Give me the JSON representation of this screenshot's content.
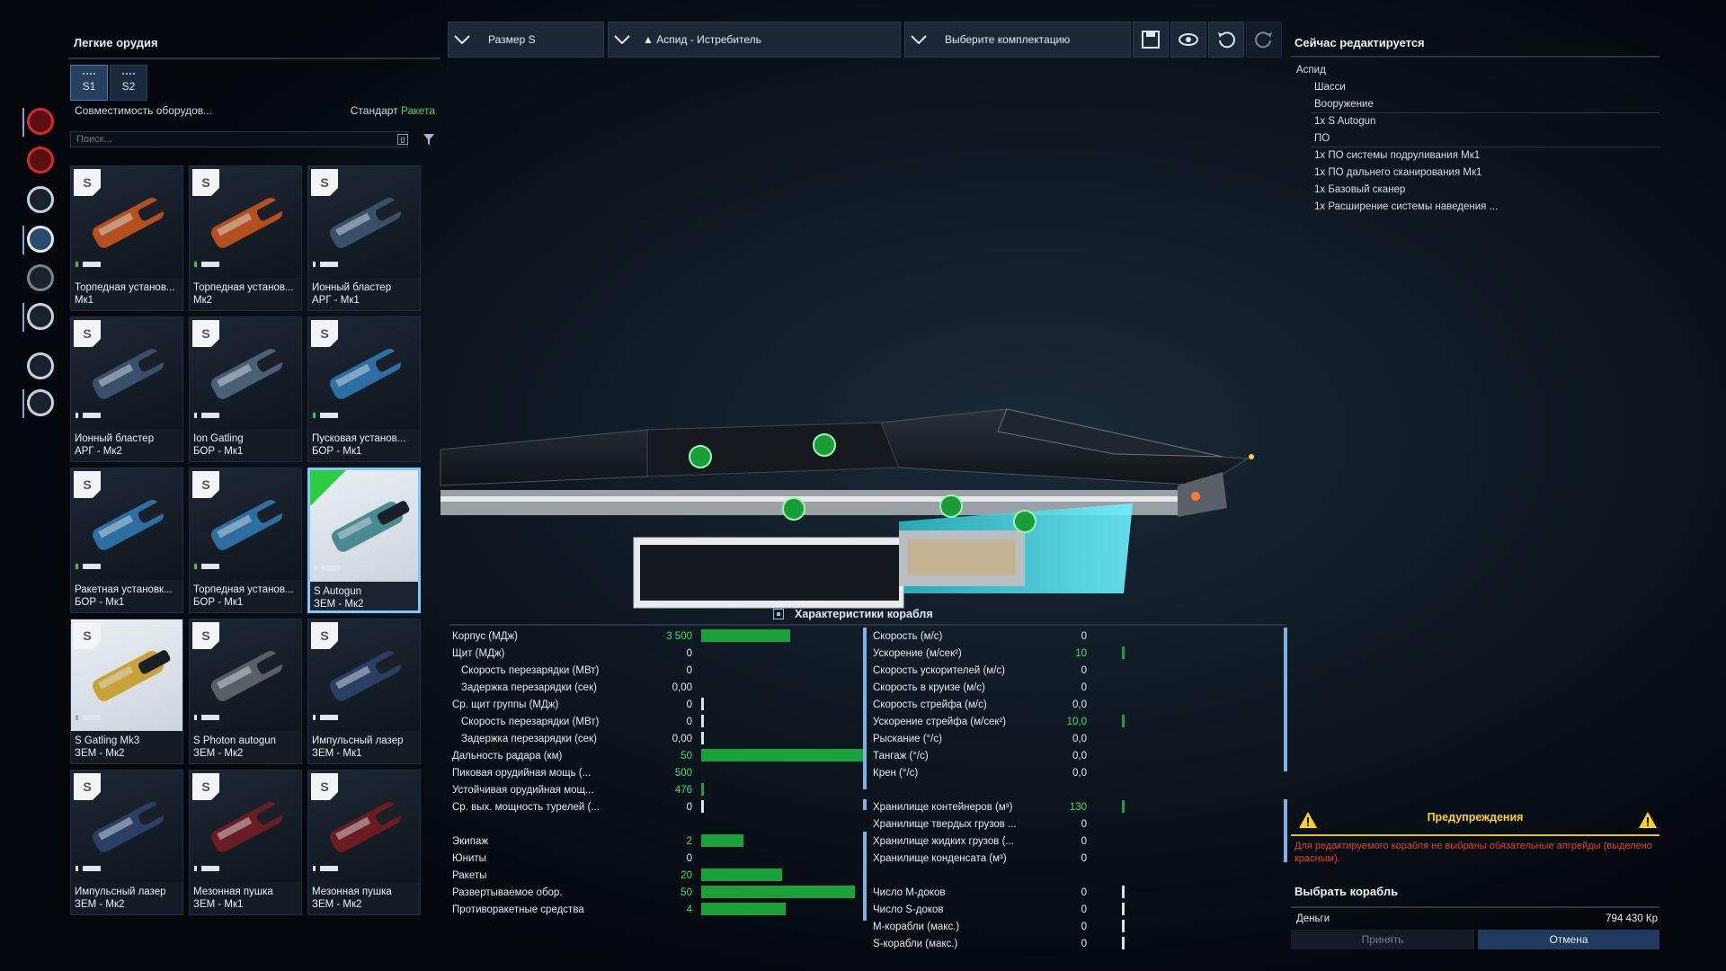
{
  "left_panel": {
    "title": "Легкие орудия",
    "size_tabs": [
      {
        "label": "S1",
        "active": true
      },
      {
        "label": "S2",
        "active": false
      }
    ],
    "compatibility_label": "Совместимость оборудов...",
    "standard_label": "Стандарт",
    "standard_value": "Ракета",
    "search_placeholder": "Поиск...",
    "search_clear": "0",
    "items": [
      {
        "name1": "Торпедная установ...",
        "name2": "Мк1"
      },
      {
        "name1": "Торпедная установ...",
        "name2": "Мк2"
      },
      {
        "name1": "Ионный бластер",
        "name2": "АРГ - Мк1"
      },
      {
        "name1": "Ионный бластер",
        "name2": "АРГ - Мк2"
      },
      {
        "name1": "Ion Gatling",
        "name2": "БОР - Мк1"
      },
      {
        "name1": "Пусковая установ...",
        "name2": "БОР - Мк1"
      },
      {
        "name1": "Ракетная установк...",
        "name2": "БОР - Мк1"
      },
      {
        "name1": "Торпедная установ...",
        "name2": "БОР - Мк1"
      },
      {
        "name1": "S Autogun",
        "name2": "ЗЕМ - Мк2"
      },
      {
        "name1": "S Gatling Mk3",
        "name2": "ЗЕМ - Мк2"
      },
      {
        "name1": "S Photon autogun",
        "name2": "ЗЕМ - Мк2"
      },
      {
        "name1": "Импульсный лазер",
        "name2": "ЗЕМ - Мк1"
      },
      {
        "name1": "Импульсный лазер",
        "name2": "ЗЕМ - Мк2"
      },
      {
        "name1": "Мезонная пушка",
        "name2": "ЗЕМ - Мк1"
      },
      {
        "name1": "Мезонная пушка",
        "name2": "ЗЕМ - Мк2"
      }
    ]
  },
  "top_bar": {
    "size_dropdown": "Размер S",
    "ship_dropdown": "▲ Аспид - Истребитель",
    "loadout_dropdown": "Выберите комплектацию"
  },
  "right_panel": {
    "title": "Сейчас редактируется",
    "ship": "Аспид",
    "chassis": "Шасси",
    "weapons_header": "Вооружение",
    "weapons": [
      "1x S Autogun"
    ],
    "software_header": "ПО",
    "software": [
      "1x ПО системы подруливания Мк1",
      "1x ПО дальнего сканирования Мк1",
      "1x Базовый сканер",
      "1x Расширение системы наведения ..."
    ],
    "warnings_title": "Предупреждения",
    "warnings_text": "Для редактируемого корабля не выбраны обязательные апгрейды (выделено красным).",
    "select_ship": "Выбрать корабль",
    "money_label": "Деньги",
    "money_value": "794 430 Кр",
    "accept": "Принять",
    "cancel": "Отмена"
  },
  "stats": {
    "title": "Характеристики корабля",
    "left": [
      {
        "label": "Корпус (МДж)",
        "value": "3 500",
        "green": true,
        "bar": 0.55
      },
      {
        "label": "Щит (МДж)",
        "value": "0",
        "green": false,
        "bar": 0
      },
      {
        "label": "Скорость перезарядки (МВт)",
        "value": "0",
        "green": false,
        "bar": 0,
        "indent": true
      },
      {
        "label": "Задержка перезарядки (сек)",
        "value": "0,00",
        "green": false,
        "bar": 0,
        "indent": true
      },
      {
        "label": "Ср. щит группы (МДж)",
        "value": "0",
        "green": false,
        "bar": 0,
        "tick": true
      },
      {
        "label": "Скорость перезарядки (МВт)",
        "value": "0",
        "green": false,
        "bar": 0,
        "indent": true,
        "tick": true
      },
      {
        "label": "Задержка перезарядки (сек)",
        "value": "0,00",
        "green": false,
        "bar": 0,
        "indent": true,
        "tick": true
      },
      {
        "label": "Дальность радара (км)",
        "value": "50",
        "green": true,
        "bar": 1.0
      },
      {
        "label": "Пиковая орудийная мощь (...",
        "value": "500",
        "green": true,
        "bar": 0.0
      },
      {
        "label": "Устойчивая орудийная мощ...",
        "value": "476",
        "green": true,
        "bar": 0.0,
        "gtick": true
      },
      {
        "label": "Ср. вых. мощность турелей (...",
        "value": "0",
        "green": false,
        "bar": 0,
        "tick": true
      },
      {
        "label": "",
        "value": "",
        "green": false,
        "bar": 0
      },
      {
        "label": "Экипаж",
        "value": "2",
        "green": true,
        "bar": 0.26
      },
      {
        "label": "Юниты",
        "value": "0",
        "green": false,
        "bar": 0
      },
      {
        "label": "Ракеты",
        "value": "20",
        "green": true,
        "bar": 0.5
      },
      {
        "label": "Развертываемое обор.",
        "value": "50",
        "green": true,
        "bar": 0.95
      },
      {
        "label": "Противоракетные средства",
        "value": "4",
        "green": true,
        "bar": 0.52
      }
    ],
    "right": [
      {
        "label": "Скорость (м/с)",
        "value": "0",
        "green": false
      },
      {
        "label": "Ускорение (м/сек²)",
        "value": "10",
        "green": true
      },
      {
        "label": "Скорость ускорителей (м/с)",
        "value": "0",
        "green": false
      },
      {
        "label": "Скорость в круизе (м/с)",
        "value": "0",
        "green": false
      },
      {
        "label": "Скорость стрейфа (м/с)",
        "value": "0,0",
        "green": false
      },
      {
        "label": "Ускорение стрейфа (м/сек²)",
        "value": "10,0",
        "green": true
      },
      {
        "label": "Рыскание (°/с)",
        "value": "0,0",
        "green": false
      },
      {
        "label": "Тангаж (°/с)",
        "value": "0,0",
        "green": false
      },
      {
        "label": "Крен (°/с)",
        "value": "0,0",
        "green": false
      },
      {
        "label": "",
        "value": "",
        "green": false
      },
      {
        "label": "Хранилище контейнеров (м³)",
        "value": "130",
        "green": true
      },
      {
        "label": "Хранилище твердых грузов ...",
        "value": "0",
        "green": false
      },
      {
        "label": "Хранилище жидких грузов (...",
        "value": "0",
        "green": false
      },
      {
        "label": "Хранилище конденсата (м³)",
        "value": "0",
        "green": false
      },
      {
        "label": "",
        "value": "",
        "green": false
      },
      {
        "label": "Число М-доков",
        "value": "0",
        "green": false,
        "tick": true
      },
      {
        "label": "Число S-доков",
        "value": "0",
        "green": false,
        "tick": true
      },
      {
        "label": "М-корабли (макс.)",
        "value": "0",
        "green": false,
        "tick": true
      },
      {
        "label": "S-корабли (макс.)",
        "value": "0",
        "green": false,
        "tick": true
      }
    ]
  },
  "colors": {
    "accent": "#3fe06a",
    "warning": "#ffd21a",
    "error": "#e63a2e",
    "selected": "#7ec7ff"
  }
}
